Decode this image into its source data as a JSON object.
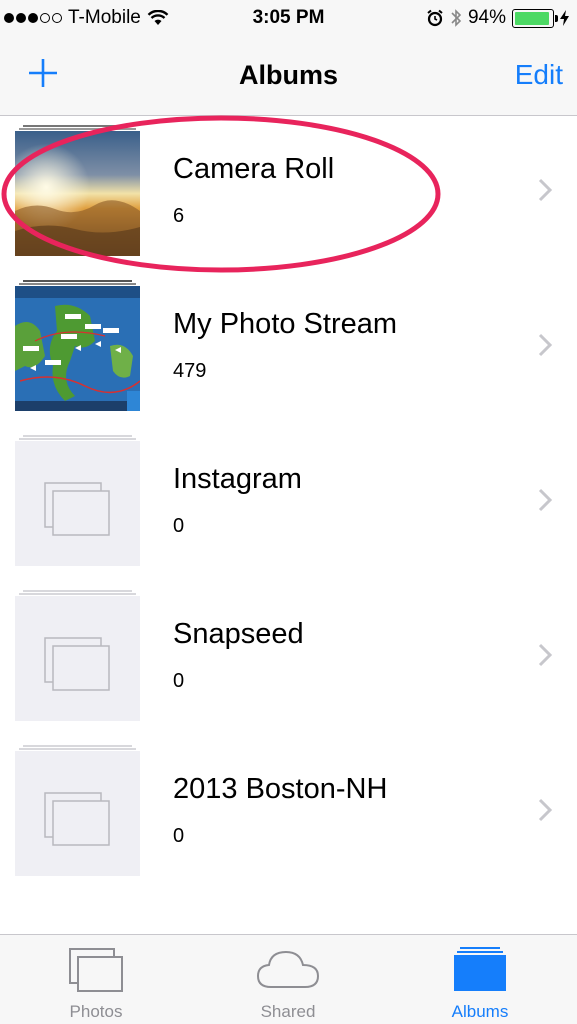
{
  "status_bar": {
    "carrier": "T-Mobile",
    "time": "3:05 PM",
    "battery": "94%",
    "battery_level": 0.94,
    "signal_bars_filled": 3,
    "signal_bars_total": 5
  },
  "nav": {
    "title": "Albums",
    "edit_label": "Edit",
    "add_icon": "plus-icon"
  },
  "albums": [
    {
      "name": "Camera Roll",
      "count": "6",
      "thumb": "sunset-photo"
    },
    {
      "name": "My Photo Stream",
      "count": "479",
      "thumb": "map-game-screenshot"
    },
    {
      "name": "Instagram",
      "count": "0",
      "thumb": "empty-album-icon"
    },
    {
      "name": "Snapseed",
      "count": "0",
      "thumb": "empty-album-icon"
    },
    {
      "name": "2013 Boston-NH",
      "count": "0",
      "thumb": "empty-album-icon"
    }
  ],
  "tabs": [
    {
      "label": "Photos",
      "icon": "photos-icon",
      "active": false
    },
    {
      "label": "Shared",
      "icon": "cloud-icon",
      "active": false
    },
    {
      "label": "Albums",
      "icon": "albums-icon",
      "active": true
    }
  ],
  "colors": {
    "accent": "#157efb",
    "annotation": "#e8245c",
    "battery": "#4cd964"
  }
}
